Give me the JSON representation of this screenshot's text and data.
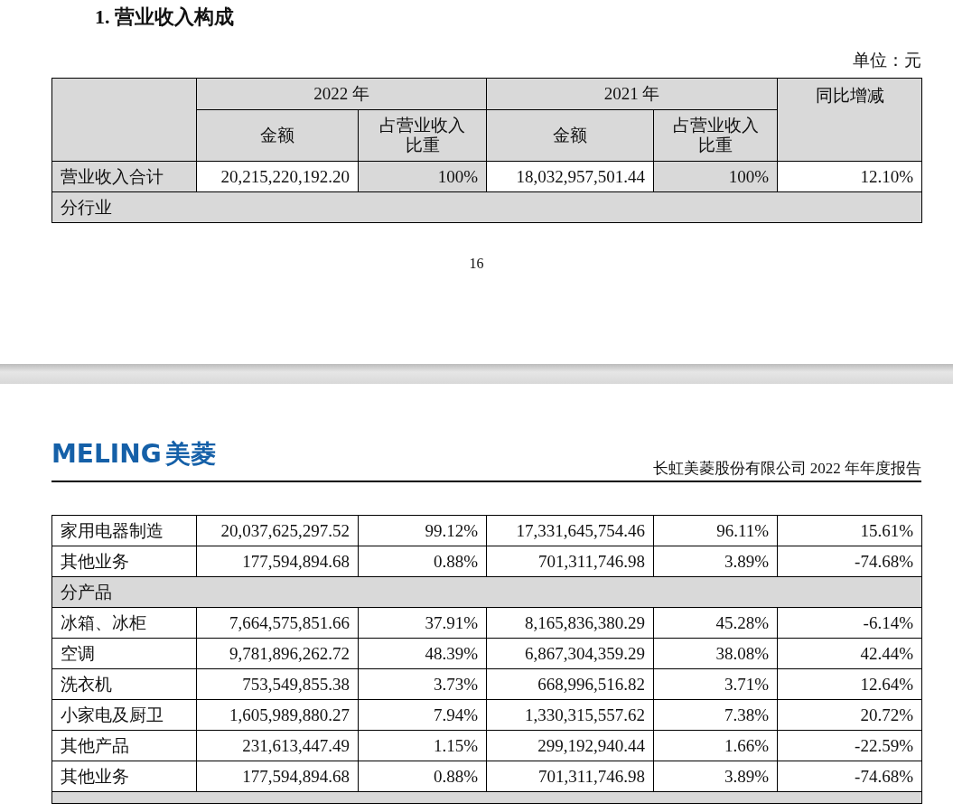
{
  "page_1": {
    "heading": "1. 营业收入构成",
    "unit": "单位：元",
    "table": {
      "years": [
        "2022 年",
        "2021 年"
      ],
      "sub_columns": [
        "金额",
        "占营业收入比重",
        "金额",
        "占营业收入比重"
      ],
      "change_column": "同比增减",
      "rows": [
        {
          "kind": "total",
          "cells": [
            "营业收入合计",
            "20,215,220,192.20",
            "100%",
            "18,032,957,501.44",
            "100%",
            "12.10%"
          ]
        },
        {
          "kind": "section",
          "label": "分行业"
        }
      ]
    },
    "page_number": "16"
  },
  "page_2": {
    "logo": {
      "latin": "MELING",
      "chinese": "美菱"
    },
    "running_header": "长虹美菱股份有限公司 2022 年年度报告",
    "table": {
      "rows": [
        {
          "kind": "data",
          "cells": [
            "家用电器制造",
            "20,037,625,297.52",
            "99.12%",
            "17,331,645,754.46",
            "96.11%",
            "15.61%"
          ]
        },
        {
          "kind": "data",
          "cells": [
            "其他业务",
            "177,594,894.68",
            "0.88%",
            "701,311,746.98",
            "3.89%",
            "-74.68%"
          ]
        },
        {
          "kind": "section",
          "label": "分产品"
        },
        {
          "kind": "data",
          "cells": [
            "冰箱、冰柜",
            "7,664,575,851.66",
            "37.91%",
            "8,165,836,380.29",
            "45.28%",
            "-6.14%"
          ]
        },
        {
          "kind": "data",
          "cells": [
            "空调",
            "9,781,896,262.72",
            "48.39%",
            "6,867,304,359.29",
            "38.08%",
            "42.44%"
          ]
        },
        {
          "kind": "data",
          "cells": [
            "洗衣机",
            "753,549,855.38",
            "3.73%",
            "668,996,516.82",
            "3.71%",
            "12.64%"
          ]
        },
        {
          "kind": "data",
          "cells": [
            "小家电及厨卫",
            "1,605,989,880.27",
            "7.94%",
            "1,330,315,557.62",
            "7.38%",
            "20.72%"
          ]
        },
        {
          "kind": "data",
          "cells": [
            "其他产品",
            "231,613,447.49",
            "1.15%",
            "299,192,940.44",
            "1.66%",
            "-22.59%"
          ]
        },
        {
          "kind": "data",
          "cells": [
            "其他业务",
            "177,594,894.68",
            "0.88%",
            "701,311,746.98",
            "3.89%",
            "-74.68%"
          ]
        },
        {
          "kind": "section"
        }
      ]
    }
  }
}
